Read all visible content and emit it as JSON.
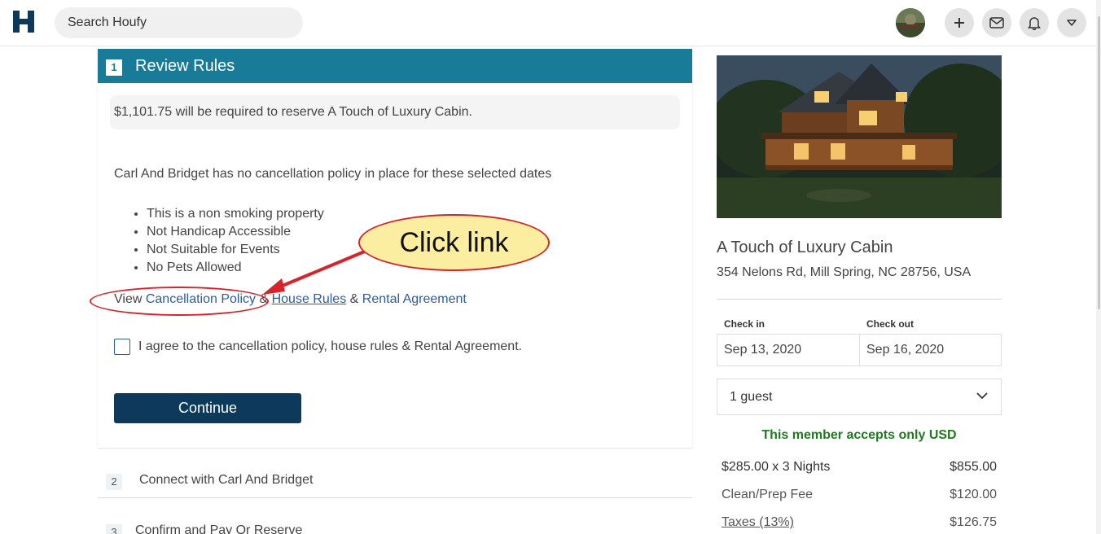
{
  "header": {
    "search_placeholder": "Search Houfy"
  },
  "step1": {
    "number": "1",
    "title": "Review Rules",
    "notice": "$1,101.75 will be required to reserve A Touch of Luxury Cabin.",
    "policy_text": "Carl And Bridget has no cancellation policy in place for these selected dates",
    "rules": [
      "This is a non smoking property",
      "Not Handicap Accessible",
      "Not Suitable for Events",
      "No Pets Allowed"
    ],
    "view_prefix": "View ",
    "cancellation_link": "Cancellation Policy",
    "amp1": " & ",
    "house_rules_link": "House Rules",
    "amp2": " & ",
    "rental_link": "Rental Agreement",
    "agree_text": "I agree to the cancellation policy, house rules & Rental Agreement.",
    "continue_label": "Continue"
  },
  "step2": {
    "number": "2",
    "title": "Connect with Carl And Bridget"
  },
  "step3": {
    "number": "3",
    "title": "Confirm and Pay Or Reserve"
  },
  "annotation": {
    "callout_text": "Click link",
    "color": "#d9232a"
  },
  "listing": {
    "title": "A Touch of Luxury Cabin",
    "address": "354 Nelons Rd, Mill Spring, NC 28756, USA",
    "checkin_label": "Check in",
    "checkout_label": "Check out",
    "checkin": "Sep 13, 2020",
    "checkout": "Sep 16, 2020",
    "guests": "1 guest",
    "usd_notice": "This member accepts only USD",
    "prices": [
      {
        "label": "$285.00 x 3 Nights",
        "amount": "$855.00"
      },
      {
        "label": "Clean/Prep Fee",
        "amount": "$120.00"
      },
      {
        "label": "Taxes (13%)",
        "amount": "$126.75"
      }
    ]
  },
  "colors": {
    "header_teal": "#187b97",
    "button_navy": "#0d3a5a",
    "link_blue": "#2c5d9a",
    "usd_green": "#1f7a1f"
  }
}
